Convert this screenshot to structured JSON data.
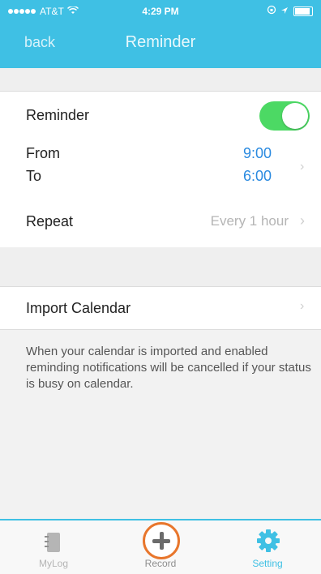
{
  "status_bar": {
    "carrier": "AT&T",
    "time": "4:29 PM"
  },
  "nav": {
    "back_label": "back",
    "title": "Reminder"
  },
  "reminder": {
    "label": "Reminder",
    "enabled": true,
    "from_label": "From",
    "from_value": "9:00",
    "to_label": "To",
    "to_value": "6:00",
    "repeat_label": "Repeat",
    "repeat_value": "Every 1 hour"
  },
  "calendar": {
    "import_label": "Import Calendar",
    "note": "When your calendar is imported and enabled reminding notifications will be cancelled if your status is busy on calendar."
  },
  "tabbar": {
    "mylog_label": "MyLog",
    "record_label": "Record",
    "setting_label": "Setting"
  },
  "colors": {
    "accent": "#3fc0e4",
    "toggle_on": "#4cd964",
    "time_value": "#2a8ae0",
    "record_ring": "#e8762c"
  }
}
